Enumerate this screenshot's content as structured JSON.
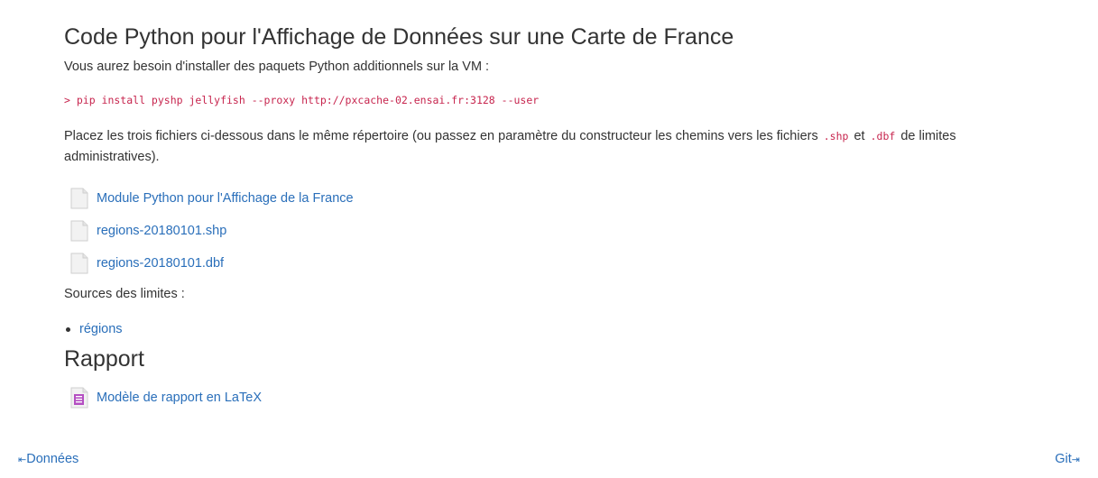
{
  "section_code": {
    "title": "Code Python pour l'Affichage de Données sur une Carte de France",
    "install_text": "Vous aurez besoin d'installer des paquets Python additionnels sur la VM :",
    "command": "> pip install pyshp jellyfish --proxy http://pxcache-02.ensai.fr:3128 --user",
    "place_text_before": "Placez les trois fichiers ci-dessous dans le même répertoire (ou passez en paramètre du constructeur les chemins vers les fichiers ",
    "shp_code": ".shp",
    "place_text_middle": " et ",
    "dbf_code": ".dbf",
    "place_text_after": " de limites administratives).",
    "files": [
      {
        "label": "Module Python pour l'Affichage de la France",
        "icon": "document-icon"
      },
      {
        "label": "regions-20180101.shp",
        "icon": "document-icon"
      },
      {
        "label": "regions-20180101.dbf",
        "icon": "document-icon"
      }
    ],
    "sources_label": "Sources des limites :",
    "sources": [
      {
        "label": "régions"
      }
    ]
  },
  "section_rapport": {
    "title": "Rapport",
    "files": [
      {
        "label": "Modèle de rapport en LaTeX",
        "icon": "text-document-icon"
      }
    ]
  },
  "nav": {
    "prev_label": "Données",
    "prev_arrow": "⇤",
    "next_label": "Git",
    "next_arrow": "⇥"
  },
  "colors": {
    "link": "#2a6fba",
    "code": "#c7254e",
    "text": "#333333"
  }
}
